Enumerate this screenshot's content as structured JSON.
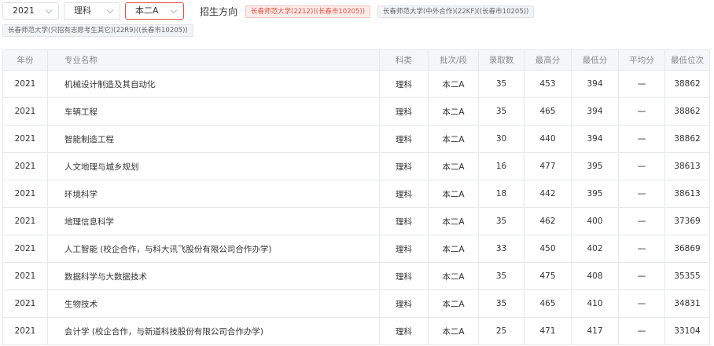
{
  "filters": {
    "year": "2021",
    "subject": "理科",
    "batch": "本二A",
    "direction_label": "招生方向",
    "directions": [
      "长春师范大学(2212)((长春市10205))",
      "长春师范大学(中外合作)(22KF)((长春市10205))",
      "长春师范大学(只招有志愿考生其它)(22R9)((长春市10205))"
    ],
    "active_direction": 0
  },
  "colors": {
    "accent": "#e0503f",
    "header_bg": "#f5f6f7",
    "border": "#e6e8eb"
  },
  "table": {
    "headers": [
      "年份",
      "专业名称",
      "科类",
      "批次/段",
      "录取数",
      "最高分",
      "最低分",
      "平均分",
      "最低位次"
    ],
    "rows": [
      [
        "2021",
        "机械设计制造及其自动化",
        "理科",
        "本二A",
        "35",
        "453",
        "394",
        "一",
        "38862"
      ],
      [
        "2021",
        "车辆工程",
        "理科",
        "本二A",
        "35",
        "465",
        "394",
        "一",
        "38862"
      ],
      [
        "2021",
        "智能制造工程",
        "理科",
        "本二A",
        "30",
        "440",
        "394",
        "一",
        "38862"
      ],
      [
        "2021",
        "人文地理与城乡规划",
        "理科",
        "本二A",
        "16",
        "477",
        "395",
        "一",
        "38613"
      ],
      [
        "2021",
        "环境科学",
        "理科",
        "本二A",
        "18",
        "442",
        "395",
        "一",
        "38613"
      ],
      [
        "2021",
        "地理信息科学",
        "理科",
        "本二A",
        "35",
        "462",
        "400",
        "一",
        "37369"
      ],
      [
        "2021",
        "人工智能 (校企合作，与科大讯飞股份有限公司合作办学)",
        "理科",
        "本二A",
        "33",
        "450",
        "402",
        "一",
        "36869"
      ],
      [
        "2021",
        "数据科学与大数据技术",
        "理科",
        "本二A",
        "35",
        "475",
        "408",
        "一",
        "35355"
      ],
      [
        "2021",
        "生物技术",
        "理科",
        "本二A",
        "35",
        "465",
        "410",
        "一",
        "34831"
      ],
      [
        "2021",
        "会计学 (校企合作，与新道科技股份有限公司合作办学)",
        "理科",
        "本二A",
        "25",
        "471",
        "417",
        "一",
        "33104"
      ]
    ]
  }
}
